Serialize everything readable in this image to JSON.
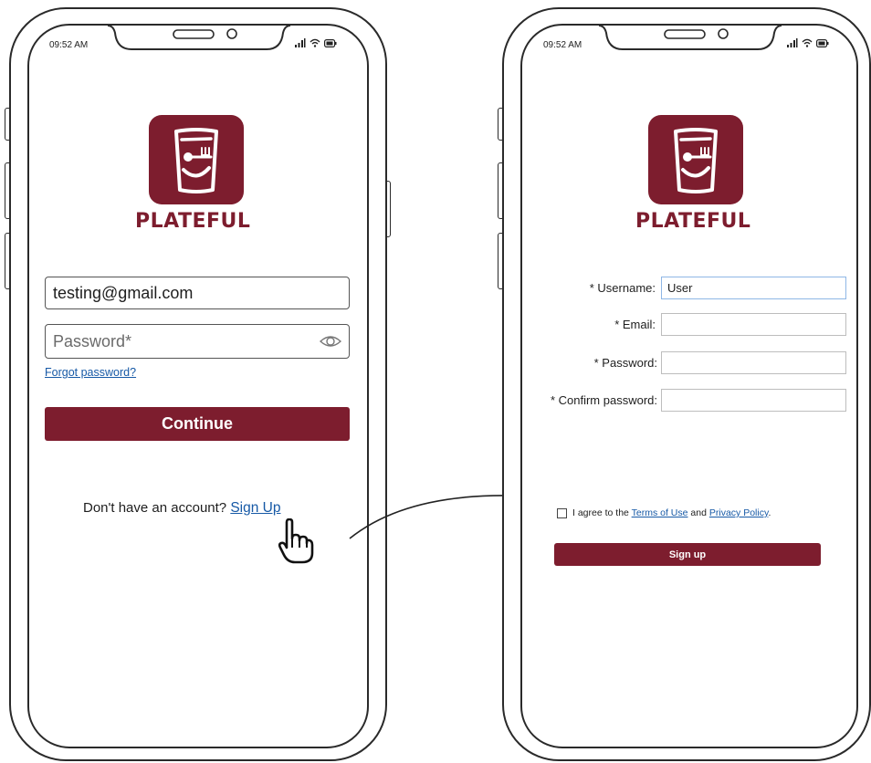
{
  "login_screen": {
    "status_time": "09:52 AM",
    "brand_name": "PLATEFUL",
    "email_value": "testing@gmail.com",
    "password_placeholder": "Password*",
    "forgot_password": "Forgot password?",
    "continue_label": "Continue",
    "no_account_text": "Don't have an account?",
    "sign_up_link": "Sign Up"
  },
  "signup_screen": {
    "status_time": "09:52 AM",
    "brand_name": "PLATEFUL",
    "username_label": "* Username:",
    "username_value": "User",
    "email_label": "* Email:",
    "password_label": "* Password:",
    "confirm_password_label": "* Confirm password:",
    "agree_prefix": "I agree to the",
    "terms_link": "Terms of Use",
    "agree_and": "and",
    "privacy_link": "Privacy Policy",
    "agree_suffix": ".",
    "sign_up_button": "Sign up"
  },
  "colors": {
    "brand": "#7d1d2e",
    "link": "#1659a6"
  },
  "icons": [
    "eye-icon",
    "pointing-hand-cursor-icon",
    "transition-arrow-icon",
    "plateful-logo-icon",
    "signal-icon",
    "wifi-icon",
    "battery-icon"
  ]
}
